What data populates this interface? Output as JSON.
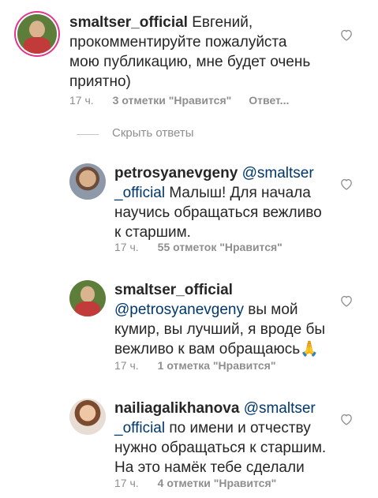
{
  "comments": [
    {
      "username": "smaltser_official",
      "text": "Евгений,\nпрокомментируйте пожалуйста\nмою публикацию, мне будет очень\nприятно)",
      "time": "17 ч.",
      "likes": "3 отметки \"Нравится\"",
      "reply": "Ответ..."
    },
    {
      "username": "petrosyanevgeny",
      "mention": "@smaltser",
      "text": "_official Малыш! Для начала\nнаучись обращаться вежливо\nк старшим.",
      "mention2": "_official",
      "time": "17 ч.",
      "likes": "55 отметок \"Нравится\""
    },
    {
      "username": "smaltser_official",
      "mention": "@petrosyanevgeny",
      "text": " вы мой\nкумир, вы лучший, я  вроде бы\nвежливо к вам обращаюсь",
      "emoji": "🙏",
      "time": "17 ч.",
      "likes": "1 отметка \"Нравится\""
    },
    {
      "username": "nailiagalikhanova",
      "mention": "@smaltser",
      "mention2": "_official",
      "text": " по имени и отчеству\nнужно обращаться к старшим.\nНа это намёк тебе сделали",
      "time": "17 ч.",
      "likes": "4 отметки \"Нравится\""
    }
  ],
  "hide_replies_label": "Скрыть ответы",
  "icons": {
    "heart": "heart-outline-icon",
    "avatar": "avatar"
  },
  "colors": {
    "mention": "#00376b",
    "meta": "#8e8e8e",
    "story_ring": "#e3348d"
  }
}
